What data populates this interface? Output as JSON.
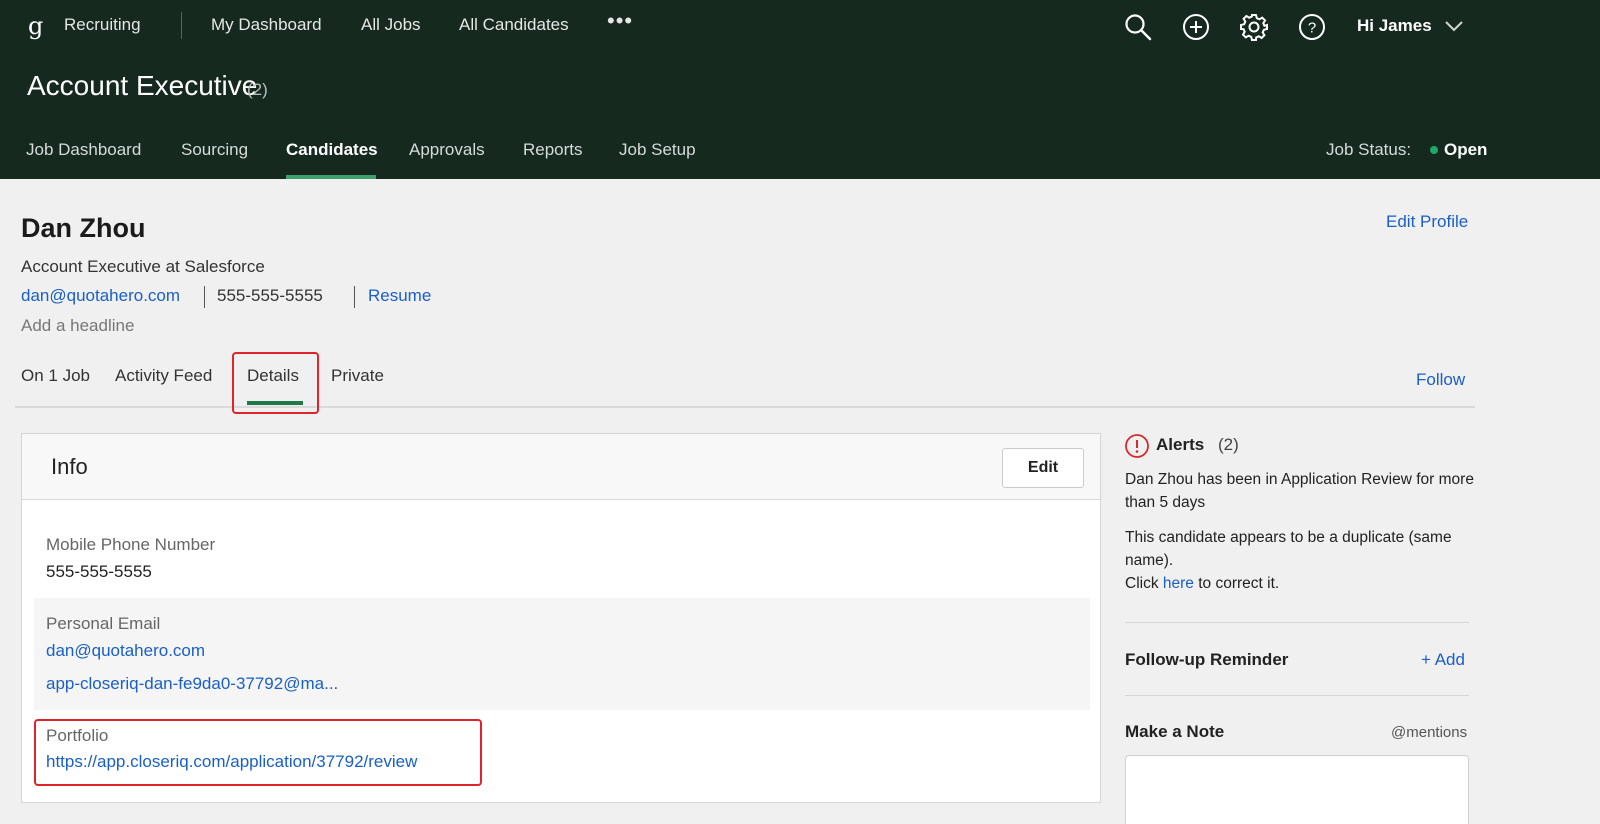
{
  "topnav": {
    "logo": "g",
    "app_name": "Recruiting",
    "links": [
      "My Dashboard",
      "All Jobs",
      "All Candidates"
    ],
    "more": "•••",
    "greeting": "Hi James"
  },
  "job": {
    "title": "Account Executive",
    "count": "(2)",
    "tabs": [
      "Job Dashboard",
      "Sourcing",
      "Candidates",
      "Approvals",
      "Reports",
      "Job Setup"
    ],
    "active_tab": "Candidates",
    "status_label": "Job Status:",
    "status_value": "Open"
  },
  "candidate": {
    "name": "Dan Zhou",
    "edit_profile": "Edit Profile",
    "role": "Account Executive at Salesforce",
    "email": "dan@quotahero.com",
    "phone": "555-555-5555",
    "resume": "Resume",
    "headline_placeholder": "Add a headline",
    "tabs": [
      "On 1 Job",
      "Activity Feed",
      "Details",
      "Private"
    ],
    "active_tab": "Details",
    "follow": "Follow"
  },
  "info": {
    "title": "Info",
    "edit": "Edit",
    "mobile_label": "Mobile Phone Number",
    "mobile_value": "555-555-5555",
    "email_label": "Personal Email",
    "emails": [
      "dan@quotahero.com",
      "app-closeriq-dan-fe9da0-37792@ma..."
    ],
    "portfolio_label": "Portfolio",
    "portfolio_url": "https://app.closeriq.com/application/37792/review"
  },
  "side": {
    "alerts_title": "Alerts",
    "alerts_count": "(2)",
    "alert_1": "Dan Zhou has been in Application Review for more than 5 days",
    "alert_2_line1": "This candidate appears to be a duplicate (same name).",
    "alert_2_click": "Click ",
    "alert_2_here": "here",
    "alert_2_tail": " to correct it.",
    "followup_title": "Follow-up Reminder",
    "followup_add": "+ Add",
    "note_title": "Make a Note",
    "note_mentions": "@mentions"
  },
  "colors": {
    "header_bg": "#15291f",
    "link": "#1a5fc7",
    "active_underline": "#1f7a4a",
    "highlight": "#e0242a",
    "status_dot": "#1fa86a"
  }
}
